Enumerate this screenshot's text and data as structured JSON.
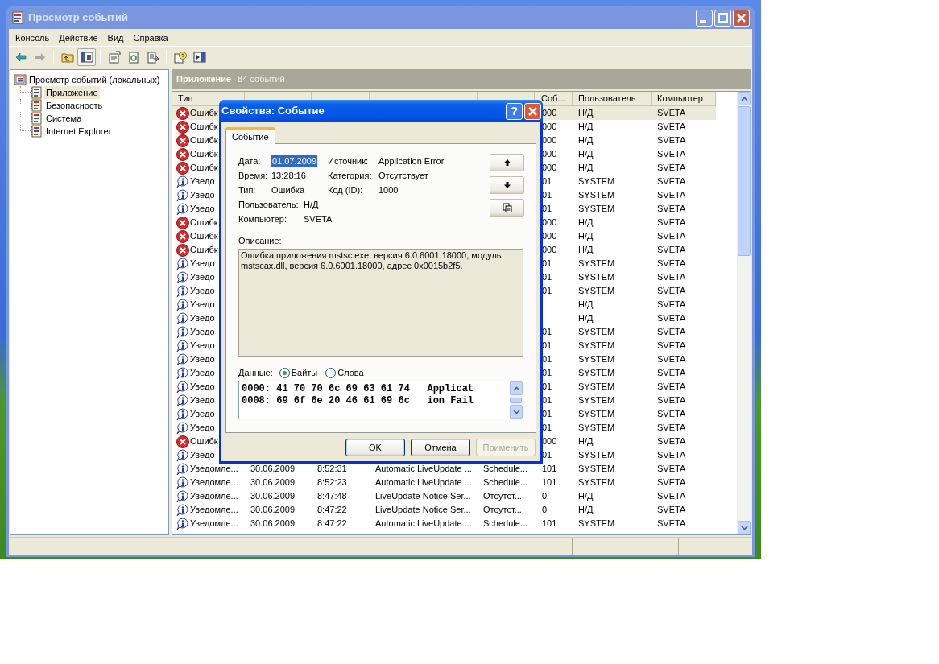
{
  "window": {
    "title": "Просмотр событий"
  },
  "menu": [
    "Консоль",
    "Действие",
    "Вид",
    "Справка"
  ],
  "tree": {
    "label": "Просмотр событий (локальных)",
    "children": [
      {
        "label": "Приложение",
        "selected": true
      },
      {
        "label": "Безопасность",
        "selected": false
      },
      {
        "label": "Система",
        "selected": false
      },
      {
        "label": "Internet Explorer",
        "selected": false
      }
    ]
  },
  "list": {
    "title": "Приложение",
    "count": "84 событий",
    "columns": {
      "type": "Тип",
      "event": "Соб...",
      "user": "Пользователь",
      "computer": "Компьютер"
    },
    "rows": [
      {
        "kind": "error",
        "selected": true,
        "type": "Ошибк",
        "event": "000",
        "user": "Н/Д",
        "computer": "SVETA"
      },
      {
        "kind": "error",
        "selected": false,
        "type": "Ошибк",
        "event": "000",
        "user": "Н/Д",
        "computer": "SVETA"
      },
      {
        "kind": "error",
        "selected": false,
        "type": "Ошибк",
        "event": "000",
        "user": "Н/Д",
        "computer": "SVETA"
      },
      {
        "kind": "error",
        "selected": false,
        "type": "Ошибк",
        "event": "000",
        "user": "Н/Д",
        "computer": "SVETA"
      },
      {
        "kind": "error",
        "selected": false,
        "type": "Ошибк",
        "event": "000",
        "user": "Н/Д",
        "computer": "SVETA"
      },
      {
        "kind": "info",
        "selected": false,
        "type": "Уведо",
        "event": "01",
        "user": "SYSTEM",
        "computer": "SVETA"
      },
      {
        "kind": "info",
        "selected": false,
        "type": "Уведо",
        "event": "01",
        "user": "SYSTEM",
        "computer": "SVETA"
      },
      {
        "kind": "info",
        "selected": false,
        "type": "Уведо",
        "event": "01",
        "user": "SYSTEM",
        "computer": "SVETA"
      },
      {
        "kind": "error",
        "selected": false,
        "type": "Ошибк",
        "event": "000",
        "user": "Н/Д",
        "computer": "SVETA"
      },
      {
        "kind": "error",
        "selected": false,
        "type": "Ошибк",
        "event": "000",
        "user": "Н/Д",
        "computer": "SVETA"
      },
      {
        "kind": "error",
        "selected": false,
        "type": "Ошибк",
        "event": "000",
        "user": "Н/Д",
        "computer": "SVETA"
      },
      {
        "kind": "info",
        "selected": false,
        "type": "Уведо",
        "event": "01",
        "user": "SYSTEM",
        "computer": "SVETA"
      },
      {
        "kind": "info",
        "selected": false,
        "type": "Уведо",
        "event": "01",
        "user": "SYSTEM",
        "computer": "SVETA"
      },
      {
        "kind": "info",
        "selected": false,
        "type": "Уведо",
        "event": "01",
        "user": "SYSTEM",
        "computer": "SVETA"
      },
      {
        "kind": "info",
        "selected": false,
        "type": "Уведо",
        "user": "Н/Д",
        "computer": "SVETA"
      },
      {
        "kind": "info",
        "selected": false,
        "type": "Уведо",
        "user": "Н/Д",
        "computer": "SVETA"
      },
      {
        "kind": "info",
        "selected": false,
        "type": "Уведо",
        "event": "01",
        "user": "SYSTEM",
        "computer": "SVETA"
      },
      {
        "kind": "info",
        "selected": false,
        "type": "Уведо",
        "event": "01",
        "user": "SYSTEM",
        "computer": "SVETA"
      },
      {
        "kind": "info",
        "selected": false,
        "type": "Уведо",
        "event": "01",
        "user": "SYSTEM",
        "computer": "SVETA"
      },
      {
        "kind": "info",
        "selected": false,
        "type": "Уведо",
        "event": "01",
        "user": "SYSTEM",
        "computer": "SVETA"
      },
      {
        "kind": "info",
        "selected": false,
        "type": "Уведо",
        "event": "01",
        "user": "SYSTEM",
        "computer": "SVETA"
      },
      {
        "kind": "info",
        "selected": false,
        "type": "Уведо",
        "event": "01",
        "user": "SYSTEM",
        "computer": "SVETA"
      },
      {
        "kind": "info",
        "selected": false,
        "type": "Уведо",
        "event": "01",
        "user": "SYSTEM",
        "computer": "SVETA"
      },
      {
        "kind": "info",
        "selected": false,
        "type": "Уведо",
        "event": "01",
        "user": "SYSTEM",
        "computer": "SVETA"
      },
      {
        "kind": "error",
        "selected": false,
        "type": "Ошибк",
        "event": "000",
        "user": "Н/Д",
        "computer": "SVETA"
      },
      {
        "kind": "info",
        "selected": false,
        "type": "Уведо",
        "event": "01",
        "user": "SYSTEM",
        "computer": "SVETA"
      },
      {
        "kind": "info",
        "selected": false,
        "type": "Уведомле...",
        "date": "30.06.2009",
        "time": "8:52:31",
        "source": "Automatic LiveUpdate ...",
        "category": "Schedule...",
        "event": "101",
        "user": "SYSTEM",
        "computer": "SVETA"
      },
      {
        "kind": "info",
        "selected": false,
        "type": "Уведомле...",
        "date": "30.06.2009",
        "time": "8:52:23",
        "source": "Automatic LiveUpdate ...",
        "category": "Schedule...",
        "event": "101",
        "user": "SYSTEM",
        "computer": "SVETA"
      },
      {
        "kind": "info",
        "selected": false,
        "type": "Уведомле...",
        "date": "30.06.2009",
        "time": "8:47:48",
        "source": "LiveUpdate Notice Ser...",
        "category": "Отсутст...",
        "event": "0",
        "user": "Н/Д",
        "computer": "SVETA"
      },
      {
        "kind": "info",
        "selected": false,
        "type": "Уведомле...",
        "date": "30.06.2009",
        "time": "8:47:22",
        "source": "LiveUpdate Notice Ser...",
        "category": "Отсутст...",
        "event": "0",
        "user": "Н/Д",
        "computer": "SVETA"
      },
      {
        "kind": "info",
        "selected": false,
        "type": "Уведомле...",
        "date": "30.06.2009",
        "time": "8:47:22",
        "source": "Automatic LiveUpdate ...",
        "category": "Schedule...",
        "event": "101",
        "user": "SYSTEM",
        "computer": "SVETA"
      }
    ]
  },
  "dialog": {
    "title": "Свойства: Событие",
    "help_button": "?",
    "tab": {
      "label": "Событие",
      "selected": true
    },
    "fields": [
      {
        "label": "Дата:",
        "value": "01.07.2009",
        "selected": true
      },
      {
        "label": "Источник:",
        "value": "Application Error",
        "selected": false
      },
      {
        "label": "Время:",
        "value": "13:28:16",
        "selected": false
      },
      {
        "label": "Категория:",
        "value": "Отсутствует",
        "selected": false
      },
      {
        "label": "Тип:",
        "value": "Ошибка",
        "selected": false
      },
      {
        "label": "Код (ID):",
        "value": "1000",
        "selected": false
      },
      {
        "label": "Пользователь:",
        "value": "Н/Д",
        "selected": false
      },
      {
        "label": "Компьютер:",
        "value": "SVETA",
        "selected": false
      }
    ],
    "description_label": "Описание:",
    "description": "Ошибка приложения mstsc.exe, версия 6.0.6001.18000, модуль mstscax.dll, версия 6.0.6001.18000, адрес 0x0015b2f5.",
    "data_label": "Данные:",
    "data_modes": [
      {
        "label": "Байты",
        "selected": true
      },
      {
        "label": "Слова",
        "selected": false
      }
    ],
    "data_lines": [
      "0000: 41 70 70 6c 69 63 61 74   Applicat",
      "0008: 69 6f 6e 20 46 61 69 6c   ion Fail"
    ],
    "buttons": [
      {
        "label": "OK",
        "disabled": false
      },
      {
        "label": "Отмена",
        "disabled": false
      },
      {
        "label": "Применить",
        "disabled": true
      }
    ]
  }
}
